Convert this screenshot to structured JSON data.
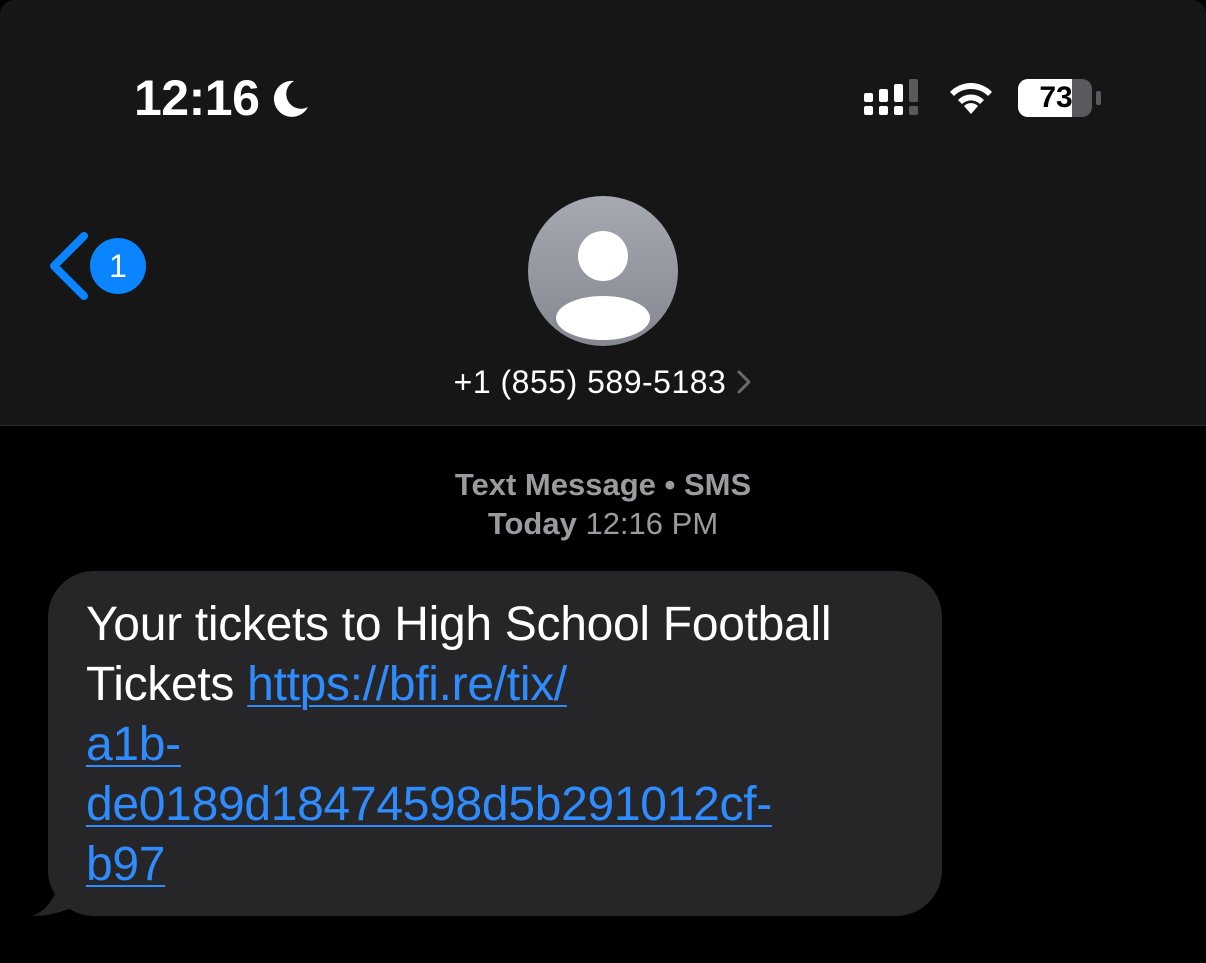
{
  "status_bar": {
    "time": "12:16",
    "battery": "73",
    "icons": [
      "moon-icon",
      "signal-icon",
      "wifi-icon",
      "battery-icon"
    ]
  },
  "nav": {
    "back_badge": "1",
    "contact": "+1 (855) 589-5183"
  },
  "conversation": {
    "message_type": "Text Message • SMS",
    "date_day": "Today",
    "date_time": "12:16 PM",
    "message": {
      "text_line1": "Your tickets to High School Football",
      "text_line2": "Tickets ",
      "link_line1": "https://bfi.re/tix/",
      "link_line2": "a1b-",
      "link_line3": "de0189d18474598d5b291012cf-",
      "link_line4": "b97"
    }
  },
  "colors": {
    "header_bg": "#161616",
    "bubble_bg": "#262628",
    "accent": "#0a84ff",
    "link": "#2f8cff",
    "meta_text": "#9a9a9f"
  }
}
